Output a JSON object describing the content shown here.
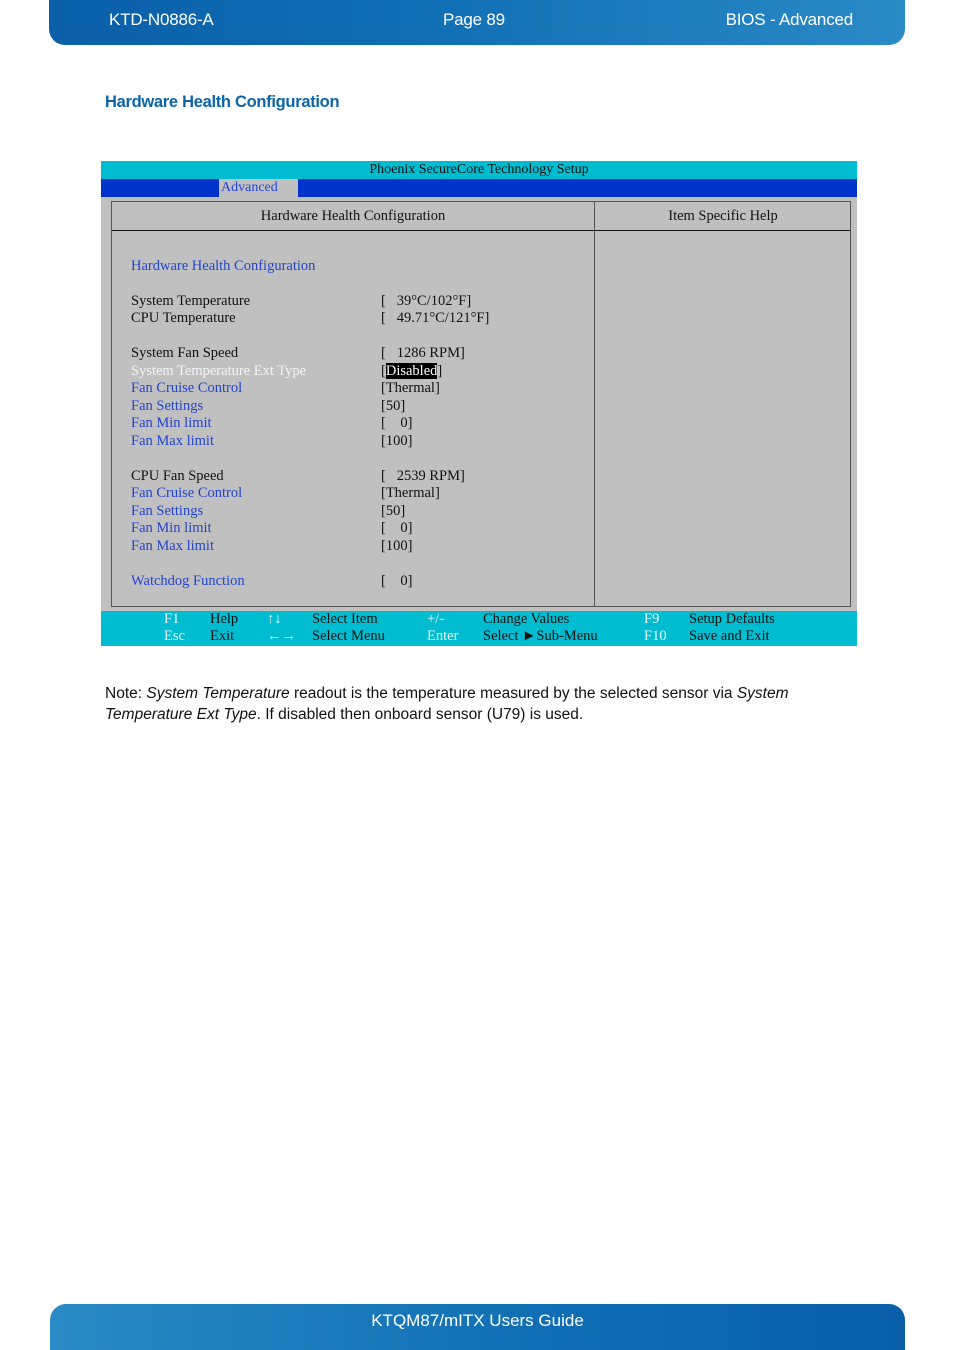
{
  "page_header": {
    "doc_id": "KTD-N0886-A",
    "page": "Page 89",
    "section": "BIOS  - Advanced"
  },
  "section_title": "Hardware Health Configuration",
  "bios": {
    "title": "Phoenix SecureCore Technology Setup",
    "active_tab": "Advanced",
    "main_header": "Hardware Health Configuration",
    "help_header": "Item Specific Help",
    "rows": [
      {
        "label": "Hardware Health Configuration",
        "value": "",
        "style": "blue"
      },
      {
        "label": "System Temperature",
        "value": "[   39°C/102°F]",
        "style": "black"
      },
      {
        "label": "CPU Temperature",
        "value": "[   49.71°C/121°F]",
        "style": "black"
      },
      {
        "label": "System Fan Speed",
        "value": "[   1286 RPM]",
        "style": "black"
      },
      {
        "label": "System Temperature Ext Type",
        "value": "Disabled",
        "style": "white",
        "selected": true
      },
      {
        "label": "Fan Cruise Control",
        "value": "[Thermal]",
        "style": "blue"
      },
      {
        "label": "Fan Settings",
        "value": "[50]",
        "style": "blue"
      },
      {
        "label": "Fan Min limit",
        "value": "[    0]",
        "style": "blue"
      },
      {
        "label": "Fan Max limit",
        "value": "[100]",
        "style": "blue"
      },
      {
        "label": "CPU Fan Speed",
        "value": "[   2539 RPM]",
        "style": "black"
      },
      {
        "label": "Fan Cruise Control",
        "value": "[Thermal]",
        "style": "blue"
      },
      {
        "label": "Fan Settings",
        "value": "[50]",
        "style": "blue"
      },
      {
        "label": "Fan Min limit",
        "value": "[    0]",
        "style": "blue"
      },
      {
        "label": "Fan Max limit",
        "value": "[100]",
        "style": "blue"
      },
      {
        "label": "Watchdog Function",
        "value": "[    0]",
        "style": "blue"
      }
    ],
    "footer": [
      {
        "key": "F1",
        "desc": "Help"
      },
      {
        "key": "↑↓",
        "desc": "Select Item"
      },
      {
        "key": "+/-",
        "desc": "Change Values"
      },
      {
        "key": "F9",
        "desc": "Setup Defaults"
      },
      {
        "key": "Esc",
        "desc": "Exit"
      },
      {
        "key": "←→",
        "desc": "Select Menu"
      },
      {
        "key": "Enter",
        "desc": "Select ►Sub-Menu"
      },
      {
        "key": "F10",
        "desc": "Save and Exit"
      }
    ]
  },
  "note": {
    "prefix": "Note: ",
    "em1": "System Temperature",
    "mid": " readout is the temperature measured by the selected sensor via ",
    "em2": "System Temperature Ext Type",
    "suffix": ". If disabled then onboard sensor (U79) is used."
  },
  "page_footer": {
    "title": "KTQM87/mITX Users Guide"
  }
}
